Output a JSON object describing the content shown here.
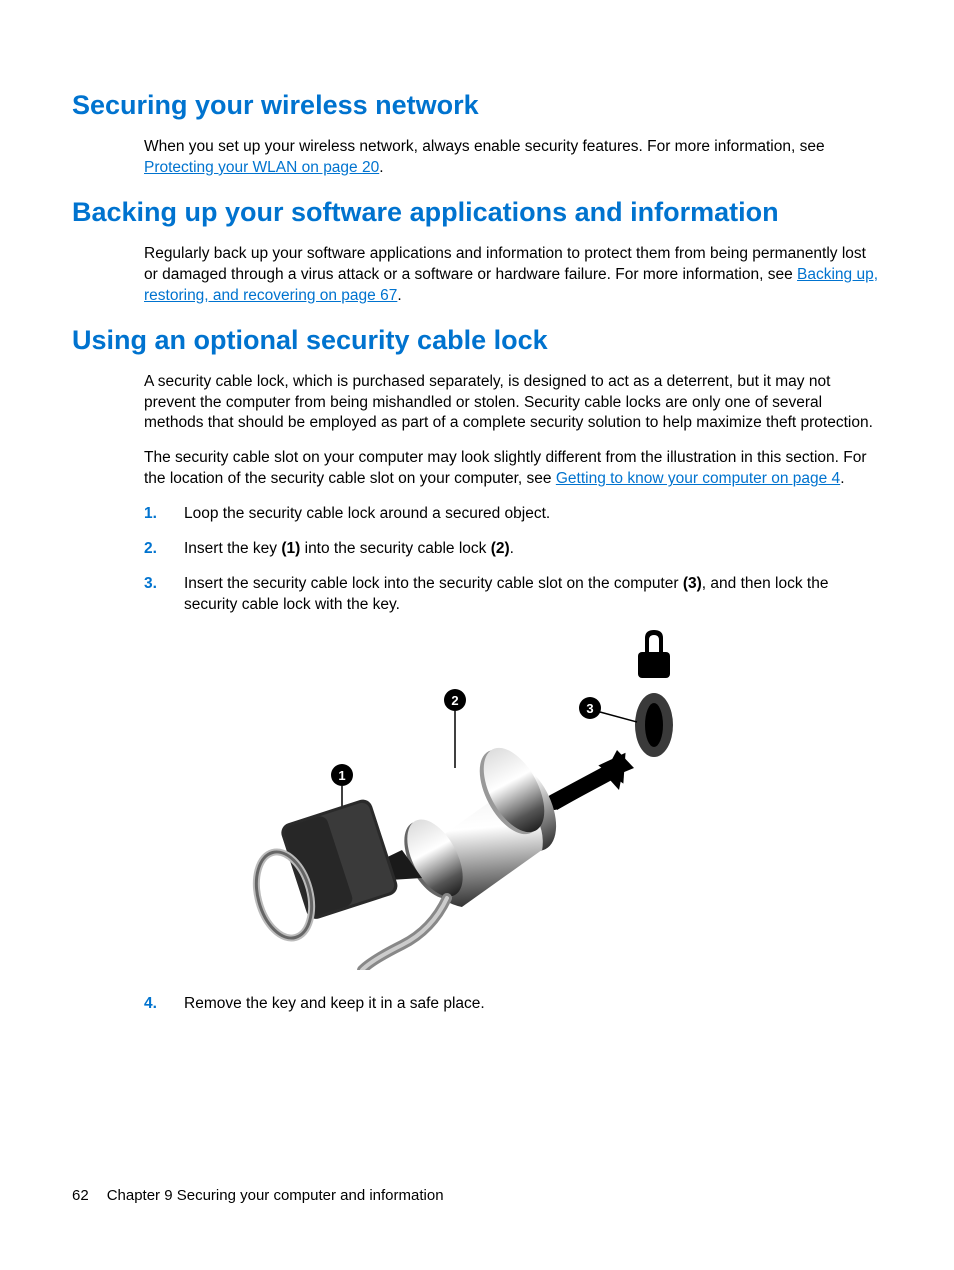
{
  "sections": {
    "s1": {
      "heading": "Securing your wireless network",
      "para1_a": "When you set up your wireless network, always enable security features. For more information, see ",
      "para1_link": "Protecting your WLAN on page 20",
      "para1_b": "."
    },
    "s2": {
      "heading": "Backing up your software applications and information",
      "para1_a": "Regularly back up your software applications and information to protect them from being permanently lost or damaged through a virus attack or a software or hardware failure. For more information, see ",
      "para1_link": "Backing up, restoring, and recovering on page 67",
      "para1_b": "."
    },
    "s3": {
      "heading": "Using an optional security cable lock",
      "para1": "A security cable lock, which is purchased separately, is designed to act as a deterrent, but it may not prevent the computer from being mishandled or stolen. Security cable locks are only one of several methods that should be employed as part of a complete security solution to help maximize theft protection.",
      "para2_a": "The security cable slot on your computer may look slightly different from the illustration in this section. For the location of the security cable slot on your computer, see ",
      "para2_link": "Getting to know your computer on page 4",
      "para2_b": ".",
      "steps": {
        "n1": "1.",
        "t1": "Loop the security cable lock around a secured object.",
        "n2": "2.",
        "t2_a": "Insert the key ",
        "t2_b1": "(1)",
        "t2_b": " into the security cable lock ",
        "t2_b2": "(2)",
        "t2_c": ".",
        "n3": "3.",
        "t3_a": "Insert the security cable lock into the security cable slot on the computer ",
        "t3_b1": "(3)",
        "t3_b": ", and then lock the security cable lock with the key.",
        "n4": "4.",
        "t4": "Remove the key and keep it in a safe place."
      }
    }
  },
  "illustration": {
    "callouts": [
      "1",
      "2",
      "3"
    ]
  },
  "footer": {
    "page_num": "62",
    "chapter": "Chapter 9   Securing your computer and information"
  }
}
